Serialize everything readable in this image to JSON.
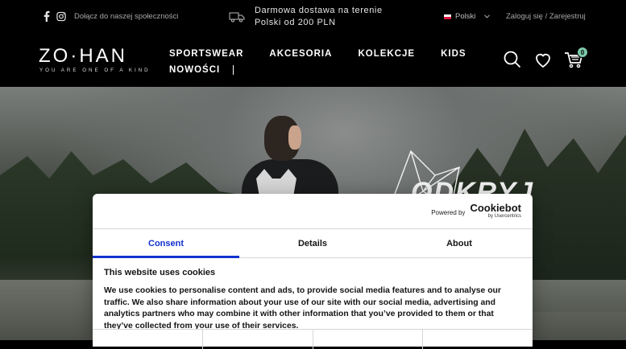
{
  "topbar": {
    "community": "Dołącz do naszej społeczności",
    "shipping_line1": "Darmowa dostawa na terenie",
    "shipping_line2": "Polski od 200 PLN",
    "language": "Polski",
    "login": "Zaloguj się",
    "separator": " / ",
    "register": "Zarejestruj"
  },
  "header": {
    "logo_main": "ZO·HAN",
    "logo_tag": "YOU ARE ONE OF A KIND",
    "nav": [
      "SPORTSWEAR",
      "AKCESORIA",
      "KOLEKCJE",
      "KIDS",
      "NOWOŚCI"
    ],
    "cart_count": "0"
  },
  "hero": {
    "slogan": "ODKRYJ"
  },
  "cookie": {
    "powered_by": "Powered by",
    "brand": "Cookiebot",
    "brand_sub": "by Usercentrics",
    "tabs": [
      "Consent",
      "Details",
      "About"
    ],
    "heading": "This website uses cookies",
    "body": "We use cookies to personalise content and ads, to provide social media features and to analyse our traffic. We also share information about your use of our site with our social media, advertising and analytics partners who may combine it with other information that you’ve provided to them or that they’ve collected from your use of their services."
  },
  "colors": {
    "accent": "#1032cf",
    "badge": "#7cc8a8"
  }
}
